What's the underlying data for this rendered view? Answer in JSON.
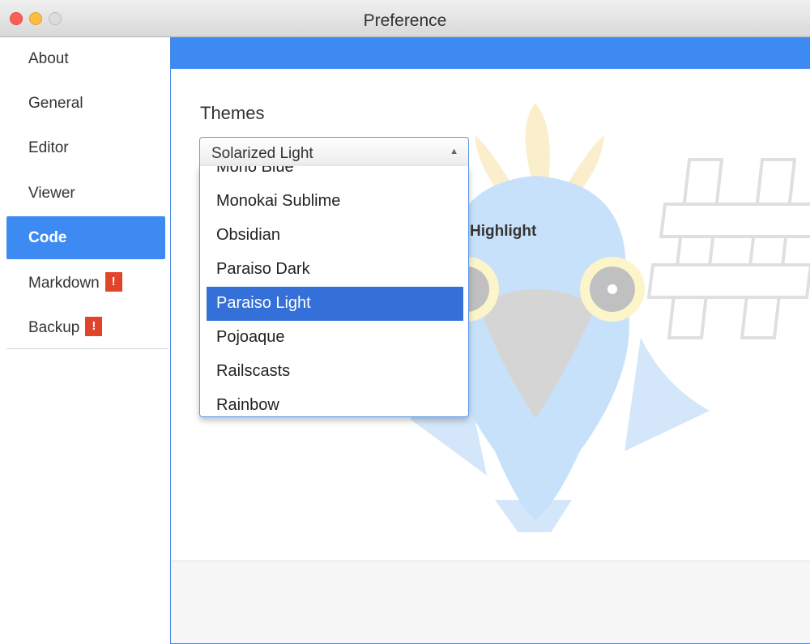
{
  "window": {
    "title": "Preference"
  },
  "sidebar": {
    "items": [
      {
        "label": "About"
      },
      {
        "label": "General"
      },
      {
        "label": "Editor"
      },
      {
        "label": "Viewer"
      },
      {
        "label": "Code",
        "active": true
      },
      {
        "label": "Markdown",
        "badge": "!"
      },
      {
        "label": "Backup",
        "badge": "!"
      }
    ]
  },
  "main": {
    "themes_label": "Themes",
    "highlight_label": "Highlight",
    "select": {
      "value": "Solarized Light",
      "options": [
        "Mono Blue",
        "Monokai Sublime",
        "Obsidian",
        "Paraiso Dark",
        "Paraiso Light",
        "Pojoaque",
        "Railscasts",
        "Rainbow"
      ],
      "highlighted": "Paraiso Light"
    }
  },
  "colors": {
    "accent": "#3d8bf2",
    "selection": "#3470d8",
    "badge": "#e0442b"
  }
}
